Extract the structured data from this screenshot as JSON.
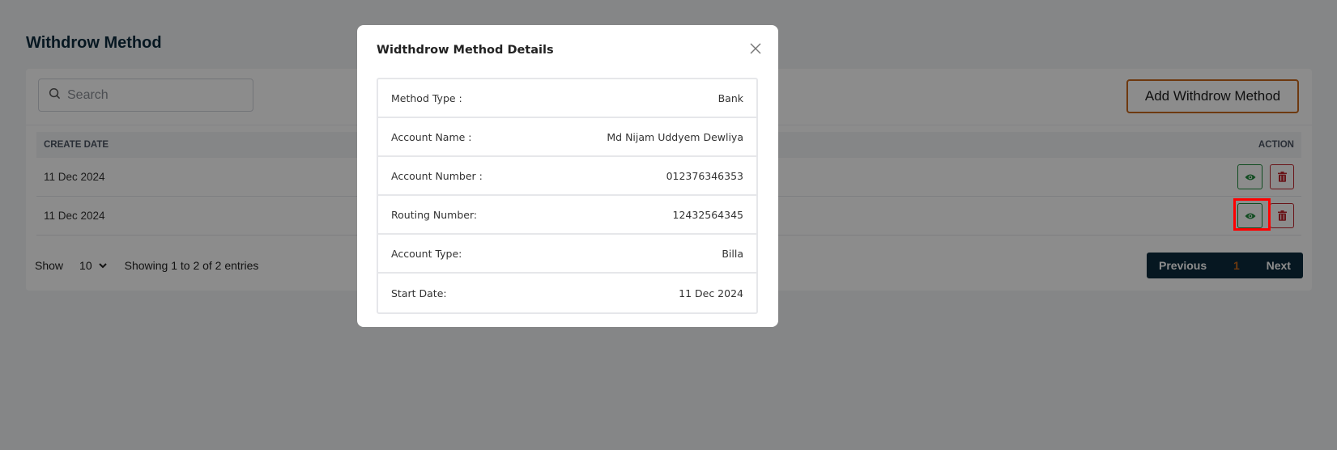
{
  "page": {
    "title": "Withdrow Method"
  },
  "toolbar": {
    "search_placeholder": "Search",
    "search_value": "",
    "add_label": "Add Withdrow Method"
  },
  "table": {
    "columns": [
      "CREATE DATE",
      "ACTION"
    ],
    "rows": [
      {
        "create_date": "11 Dec 2024"
      },
      {
        "create_date": "11 Dec 2024"
      }
    ]
  },
  "footer": {
    "show_label": "Show",
    "page_size": "10",
    "info": "Showing 1 to 2 of 2 entries"
  },
  "pagination": {
    "previous": "Previous",
    "current": "1",
    "next": "Next"
  },
  "modal": {
    "title": "Widthdrow Method Details",
    "rows": [
      {
        "label": "Method Type :",
        "value": "Bank"
      },
      {
        "label": "Account Name :",
        "value": "Md Nijam Uddyem Dewliya"
      },
      {
        "label": "Account Number :",
        "value": "012376346353"
      },
      {
        "label": "Routing Number:",
        "value": "12432564345"
      },
      {
        "label": "Account Type:",
        "value": "Billa"
      },
      {
        "label": "Start Date:",
        "value": "11 Dec 2024"
      }
    ]
  },
  "colors": {
    "brand_dark": "#0b2a3c",
    "accent_orange": "#c8681c",
    "view_green": "#1f8a3c",
    "delete_red": "#c0262d",
    "highlight": "#ff0000"
  },
  "icons": [
    "search-icon",
    "eye-icon",
    "trash-icon",
    "chevron-down-icon",
    "close-icon"
  ]
}
